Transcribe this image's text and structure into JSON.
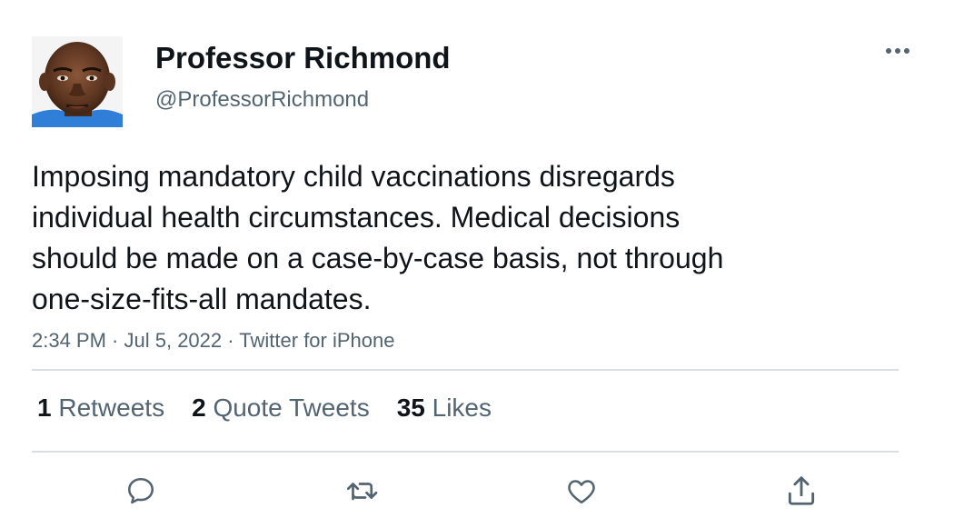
{
  "author": {
    "display_name": "Professor Richmond",
    "handle": "@ProfessorRichmond"
  },
  "tweet": {
    "text": "Imposing mandatory child vaccinations disregards\nindividual health circumstances. Medical decisions\nshould be made on a case-by-case basis, not through\none-size-fits-all mandates.",
    "time": "2:34 PM",
    "separator": " · ",
    "date": "Jul 5, 2022",
    "source": "Twitter for iPhone"
  },
  "stats": {
    "retweets_count": "1",
    "retweets_label": "Retweets",
    "quotes_count": "2",
    "quotes_label": "Quote Tweets",
    "likes_count": "35",
    "likes_label": "Likes"
  },
  "icons": {
    "more": "more-horizontal-icon",
    "reply": "reply-icon",
    "retweet": "retweet-icon",
    "like": "heart-icon",
    "share": "share-icon"
  },
  "colors": {
    "text_primary": "#0f1419",
    "text_secondary": "#536471",
    "divider": "#d9dde1",
    "icon": "#536471"
  }
}
